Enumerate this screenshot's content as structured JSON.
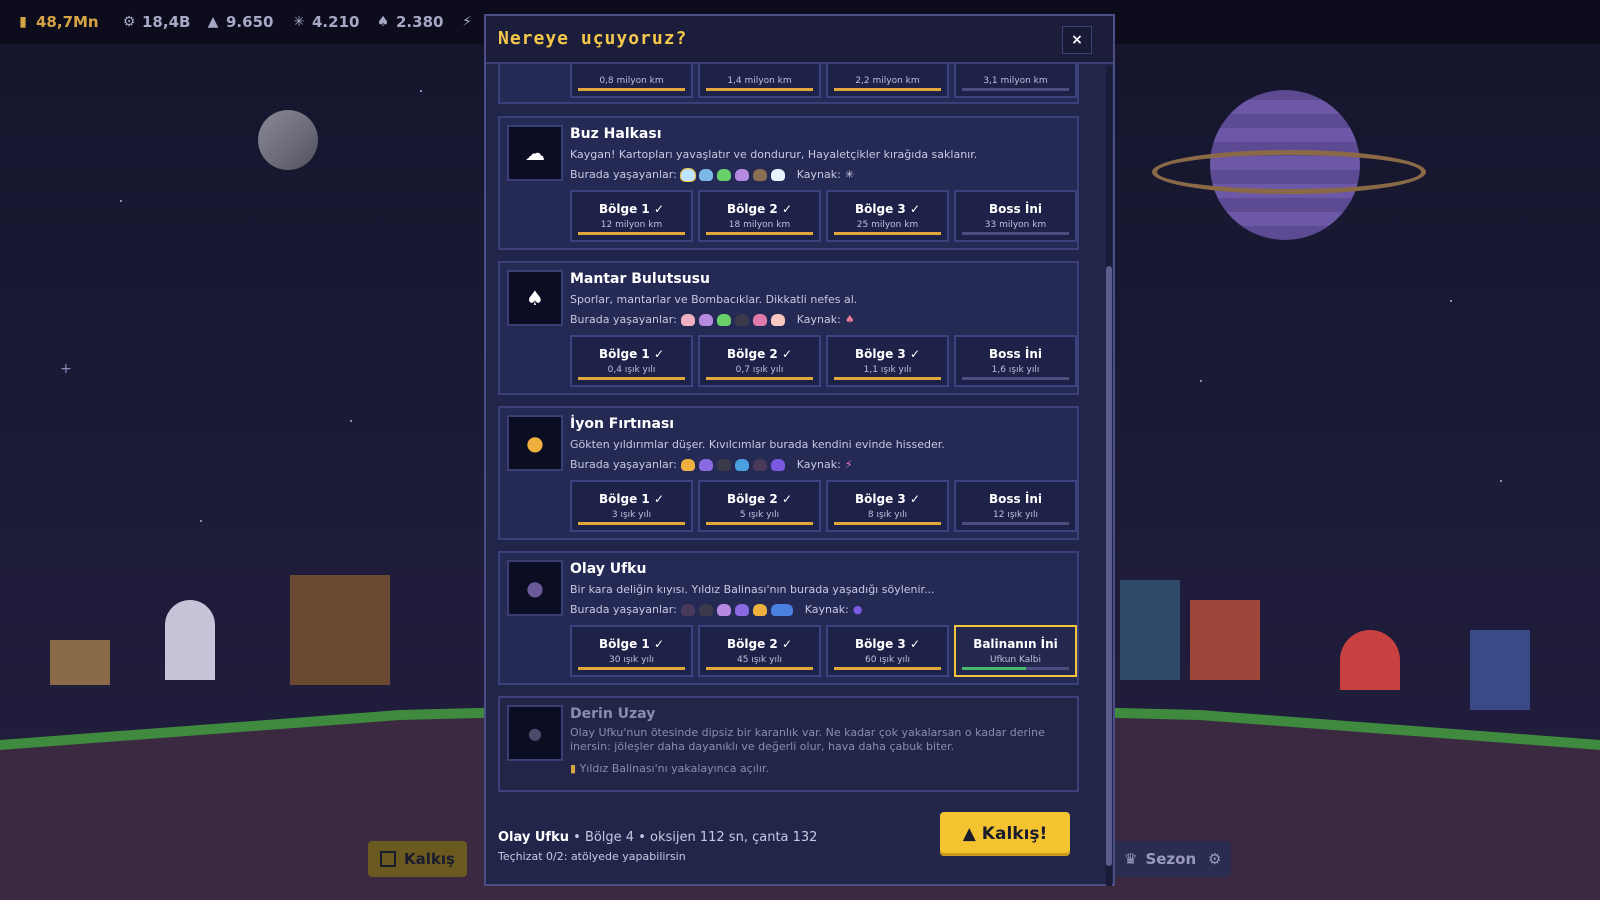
{
  "resources": [
    {
      "icon": "coin-icon",
      "value": "48,7Mn",
      "color": "#d6a546"
    },
    {
      "icon": "gear-icon",
      "value": "18,4B",
      "color": "#a9a7c6"
    },
    {
      "icon": "crystal-icon",
      "value": "9.650",
      "color": "#a9a7c6"
    },
    {
      "icon": "snowflake-icon",
      "value": "4.210",
      "color": "#a9a7c6"
    },
    {
      "icon": "mushroom-icon",
      "value": "2.380",
      "color": "#a9a7c6"
    },
    {
      "icon": "lightning-icon",
      "value": "",
      "color": "#a9a7c6"
    }
  ],
  "game_buttons": {
    "launch": "Kalkış",
    "season": "Sezon"
  },
  "modal": {
    "title": "Nereye uçuyoruz?",
    "close": "×",
    "top_row": [
      "0,8 milyon km",
      "1,4 milyon km",
      "2,2 milyon km",
      "3,1 milyon km"
    ],
    "inhabitants_label": "Burada yaşayanlar:",
    "resource_label": "Kaynak:",
    "destinations": [
      {
        "name": "Buz Halkası",
        "desc": "Kaygan! Kartopları yavaşlatır ve dondurur, Hayaletçikler kırağıda saklanır.",
        "resource_icon": "snowflake-icon",
        "zones": [
          {
            "t": "Bölge 1 ✓",
            "d": "12 milyon km"
          },
          {
            "t": "Bölge 2 ✓",
            "d": "18 milyon km"
          },
          {
            "t": "Bölge 3 ✓",
            "d": "25 milyon km"
          },
          {
            "t": "Boss İni",
            "d": "33 milyon km"
          }
        ]
      },
      {
        "name": "Mantar Bulutsusu",
        "desc": "Sporlar, mantarlar ve Bombacıklar. Dikkatli nefes al.",
        "resource_icon": "mushroom-icon",
        "zones": [
          {
            "t": "Bölge 1 ✓",
            "d": "0,4 ışık yılı"
          },
          {
            "t": "Bölge 2 ✓",
            "d": "0,7 ışık yılı"
          },
          {
            "t": "Bölge 3 ✓",
            "d": "1,1 ışık yılı"
          },
          {
            "t": "Boss İni",
            "d": "1,6 ışık yılı"
          }
        ]
      },
      {
        "name": "İyon Fırtınası",
        "desc": "Gökten yıldırımlar düşer. Kıvılcımlar burada kendini evinde hisseder.",
        "resource_icon": "lightning-icon",
        "zones": [
          {
            "t": "Bölge 1 ✓",
            "d": "3 ışık yılı"
          },
          {
            "t": "Bölge 2 ✓",
            "d": "5 ışık yılı"
          },
          {
            "t": "Bölge 3 ✓",
            "d": "8 ışık yılı"
          },
          {
            "t": "Boss İni",
            "d": "12 ışık yılı"
          }
        ]
      },
      {
        "name": "Olay Ufku",
        "desc": "Bir kara deliğin kıyısı. Yıldız Balinası'nın burada yaşadığı söylenir...",
        "resource_icon": "orb-icon",
        "zones": [
          {
            "t": "Bölge 1 ✓",
            "d": "30 ışık yılı"
          },
          {
            "t": "Bölge 2 ✓",
            "d": "45 ışık yılı"
          },
          {
            "t": "Bölge 3 ✓",
            "d": "60 ışık yılı"
          },
          {
            "t": "Balinanın İni",
            "d": "Ufkun Kalbi"
          }
        ]
      }
    ],
    "locked": {
      "name": "Derin Uzay",
      "desc": "Olay Ufku'nun ötesinde dipsiz bir karanlık var. Ne kadar çok yakalarsan o kadar derine inersin: jöleşler daha dayanıklı ve değerli olur, hava daha çabuk biter.",
      "lock": "Yıldız Balinası'nı yakalayınca açılır."
    },
    "footer": {
      "dest": "Olay Ufku",
      "zone": "Bölge 4",
      "info": "oksijen 112 sn, çanta 132",
      "gear": "Teçhizat 0/2:",
      "gear_hint": "atölyede yapabilirsin"
    },
    "launch": "Kalkış!"
  }
}
